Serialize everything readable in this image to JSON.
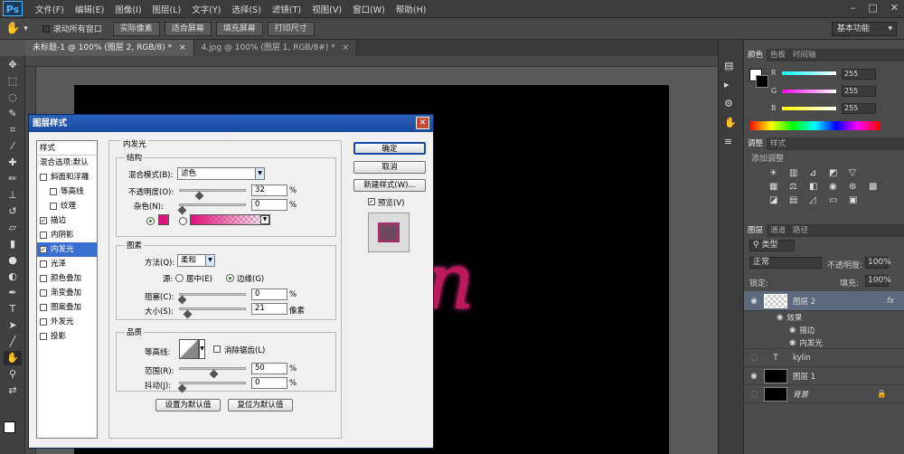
{
  "app": {
    "logo": "Ps"
  },
  "menu": [
    "文件(F)",
    "编辑(E)",
    "图像(I)",
    "图层(L)",
    "文字(Y)",
    "选择(S)",
    "滤镜(T)",
    "视图(V)",
    "窗口(W)",
    "帮助(H)"
  ],
  "options": {
    "scroll_all": "滚动所有窗口",
    "actual_pixels": "实际像素",
    "fit_screen": "适合屏幕",
    "fill_screen": "填充屏幕",
    "print_size": "打印尺寸",
    "workspace": "基本功能"
  },
  "tabs": [
    "未标题-1 @ 100% (图层 2, RGB/8) *",
    "4.jpg @ 100% (图层 1, RGB/8#) *"
  ],
  "canvas": {
    "text": "n"
  },
  "color_panel": {
    "tabs": [
      "颜色",
      "色板",
      "时间轴"
    ],
    "r_label": "R",
    "g_label": "G",
    "b_label": "B",
    "r": "255",
    "g": "255",
    "b": "255"
  },
  "adjust_panel": {
    "tabs": [
      "调整",
      "样式"
    ],
    "title": "添加调整"
  },
  "layers_panel": {
    "tabs": [
      "图层",
      "通道",
      "路径"
    ],
    "kind": "类型",
    "blend": "正常",
    "opacity_label": "不透明度:",
    "opacity": "100%",
    "lock_label": "锁定:",
    "fill_label": "填充:",
    "fill": "100%",
    "layers": [
      {
        "name": "图层 2",
        "fx": "fx"
      },
      {
        "name": "效果"
      },
      {
        "name": "描边"
      },
      {
        "name": "内发光"
      },
      {
        "name": "kylin"
      },
      {
        "name": "图层 1"
      },
      {
        "name": "背景"
      }
    ]
  },
  "dialog": {
    "title": "图层样式",
    "close": "✕",
    "styles_header": "样式",
    "styles": [
      {
        "label": "混合选项:默认",
        "cb": false,
        "has_cb": false
      },
      {
        "label": "斜面和浮雕",
        "cb": false,
        "has_cb": true
      },
      {
        "label": "等高线",
        "cb": false,
        "has_cb": true,
        "indent": true
      },
      {
        "label": "纹理",
        "cb": false,
        "has_cb": true,
        "indent": true
      },
      {
        "label": "描边",
        "cb": true,
        "has_cb": true
      },
      {
        "label": "内阴影",
        "cb": false,
        "has_cb": true
      },
      {
        "label": "内发光",
        "cb": true,
        "has_cb": true,
        "selected": true
      },
      {
        "label": "光泽",
        "cb": false,
        "has_cb": true
      },
      {
        "label": "颜色叠加",
        "cb": false,
        "has_cb": true
      },
      {
        "label": "渐变叠加",
        "cb": false,
        "has_cb": true
      },
      {
        "label": "图案叠加",
        "cb": false,
        "has_cb": true
      },
      {
        "label": "外发光",
        "cb": false,
        "has_cb": true
      },
      {
        "label": "投影",
        "cb": false,
        "has_cb": true
      }
    ],
    "section_title": "内发光",
    "structure": {
      "title": "结构",
      "blend_label": "混合模式(B):",
      "blend_value": "滤色",
      "opacity_label": "不透明度(O):",
      "opacity": "32",
      "noise_label": "杂色(N):",
      "noise": "0",
      "pct": "%",
      "color": "#e0137a"
    },
    "elements": {
      "title": "图素",
      "method_label": "方法(Q):",
      "method_value": "柔和",
      "source_label": "源:",
      "center_label": "居中(E)",
      "edge_label": "边缘(G)",
      "choke_label": "阻塞(C):",
      "choke": "0",
      "size_label": "大小(S):",
      "size": "21",
      "px": "像素"
    },
    "quality": {
      "title": "品质",
      "contour_label": "等高线:",
      "antialias_label": "消除锯齿(L)",
      "range_label": "范围(R):",
      "range": "50",
      "jitter_label": "抖动(J):",
      "jitter": "0"
    },
    "make_default": "设置为默认值",
    "reset_default": "复位为默认值",
    "ok": "确定",
    "cancel": "取消",
    "new_style": "新建样式(W)...",
    "preview": "预览(V)"
  }
}
